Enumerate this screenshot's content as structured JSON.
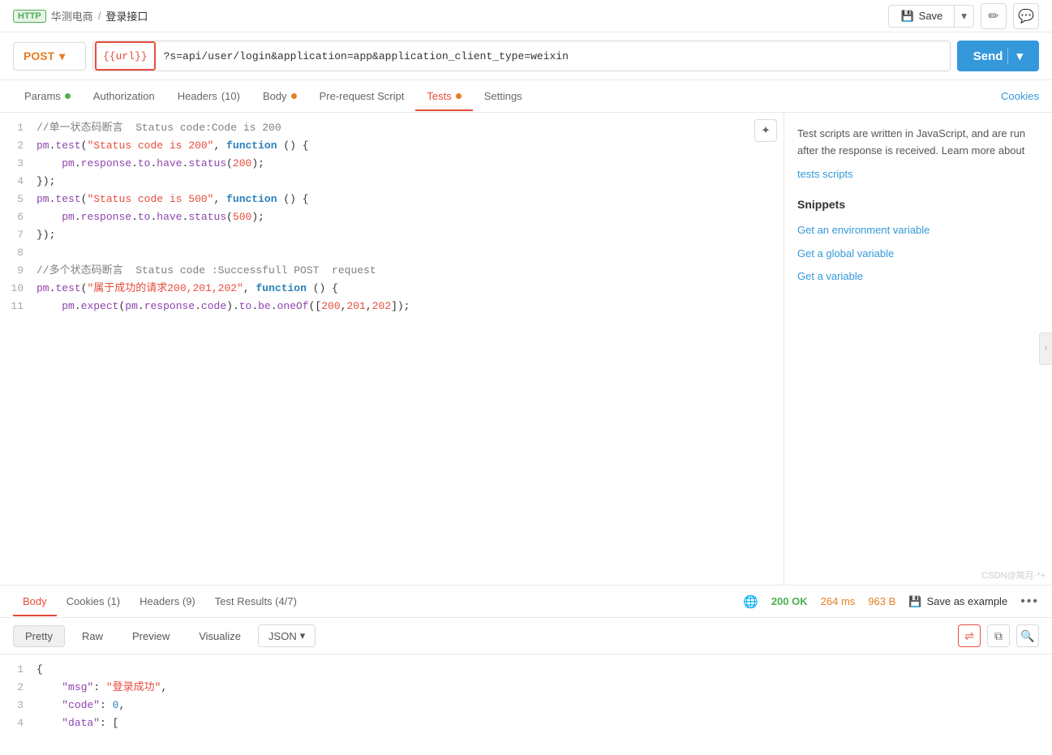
{
  "breadcrumb": {
    "http_label": "HTTP",
    "company": "华测电商",
    "separator": "/",
    "endpoint": "登录接口"
  },
  "toolbar": {
    "save_label": "Save",
    "dropdown_arrow": "▾",
    "edit_icon": "✏",
    "comment_icon": "💬"
  },
  "url_bar": {
    "method": "POST",
    "url_var": "{{url}}",
    "url_path": "?s=api/user/login&application=app&application_client_type=weixin",
    "send_label": "Send"
  },
  "tabs": [
    {
      "id": "params",
      "label": "Params",
      "dot": "green",
      "active": false
    },
    {
      "id": "authorization",
      "label": "Authorization",
      "dot": null,
      "active": false
    },
    {
      "id": "headers",
      "label": "Headers",
      "count": "(10)",
      "dot": null,
      "active": false
    },
    {
      "id": "body",
      "label": "Body",
      "dot": "orange",
      "active": false
    },
    {
      "id": "pre-request",
      "label": "Pre-request Script",
      "dot": null,
      "active": false
    },
    {
      "id": "tests",
      "label": "Tests",
      "dot": "orange",
      "active": true
    },
    {
      "id": "settings",
      "label": "Settings",
      "dot": null,
      "active": false
    }
  ],
  "tabs_right": "Cookies",
  "code_lines": [
    {
      "num": 1,
      "code": "//单一状态码断言  Status code:Code is 200",
      "type": "comment"
    },
    {
      "num": 2,
      "code": "pm.test(\"Status code is 200\", function () {",
      "type": "mixed"
    },
    {
      "num": 3,
      "code": "    pm.response.to.have.status(200);",
      "type": "mixed"
    },
    {
      "num": 4,
      "code": "});",
      "type": "default"
    },
    {
      "num": 5,
      "code": "pm.test(\"Status code is 500\", function () {",
      "type": "mixed"
    },
    {
      "num": 6,
      "code": "    pm.response.to.have.status(500);",
      "type": "mixed"
    },
    {
      "num": 7,
      "code": "});",
      "type": "default"
    },
    {
      "num": 8,
      "code": "",
      "type": "default"
    },
    {
      "num": 9,
      "code": "//多个状态码断言  Status code :Successfull POST  request",
      "type": "comment"
    },
    {
      "num": 10,
      "code": "pm.test(\"属于成功的请求200,201,202\", function () {",
      "type": "mixed"
    },
    {
      "num": 11,
      "code": "    pm.expect(pm.response.code).to.be.oneOf([200,201,202]);",
      "type": "mixed"
    }
  ],
  "right_panel": {
    "description": "Test scripts are written in JavaScript, and are run after the response is received. Learn more about",
    "link_text": "tests scripts",
    "snippets_title": "Snippets",
    "snippets": [
      "Get an environment variable",
      "Get a global variable",
      "Get a variable"
    ]
  },
  "response_tabs": [
    {
      "id": "body",
      "label": "Body",
      "active": true
    },
    {
      "id": "cookies",
      "label": "Cookies (1)",
      "active": false
    },
    {
      "id": "headers",
      "label": "Headers (9)",
      "active": false
    },
    {
      "id": "test-results",
      "label": "Test Results (4/7)",
      "active": false
    }
  ],
  "response_status": {
    "globe_icon": "🌐",
    "code": "200 OK",
    "time": "264 ms",
    "size": "963 B",
    "save_icon": "💾",
    "save_label": "Save as example",
    "more": "•••"
  },
  "format_tabs": [
    {
      "id": "pretty",
      "label": "Pretty",
      "active": true
    },
    {
      "id": "raw",
      "label": "Raw",
      "active": false
    },
    {
      "id": "preview",
      "label": "Preview",
      "active": false
    },
    {
      "id": "visualize",
      "label": "Visualize",
      "active": false
    }
  ],
  "format_select": {
    "value": "JSON",
    "arrow": "▾"
  },
  "response_lines": [
    {
      "num": 1,
      "content": "{"
    },
    {
      "num": 2,
      "content": "    \"msg\": \"登录成功\","
    },
    {
      "num": 3,
      "content": "    \"code\": 0,"
    },
    {
      "num": 4,
      "content": "    \"data\": ["
    }
  ],
  "watermark": "CSDN@简月·*+"
}
